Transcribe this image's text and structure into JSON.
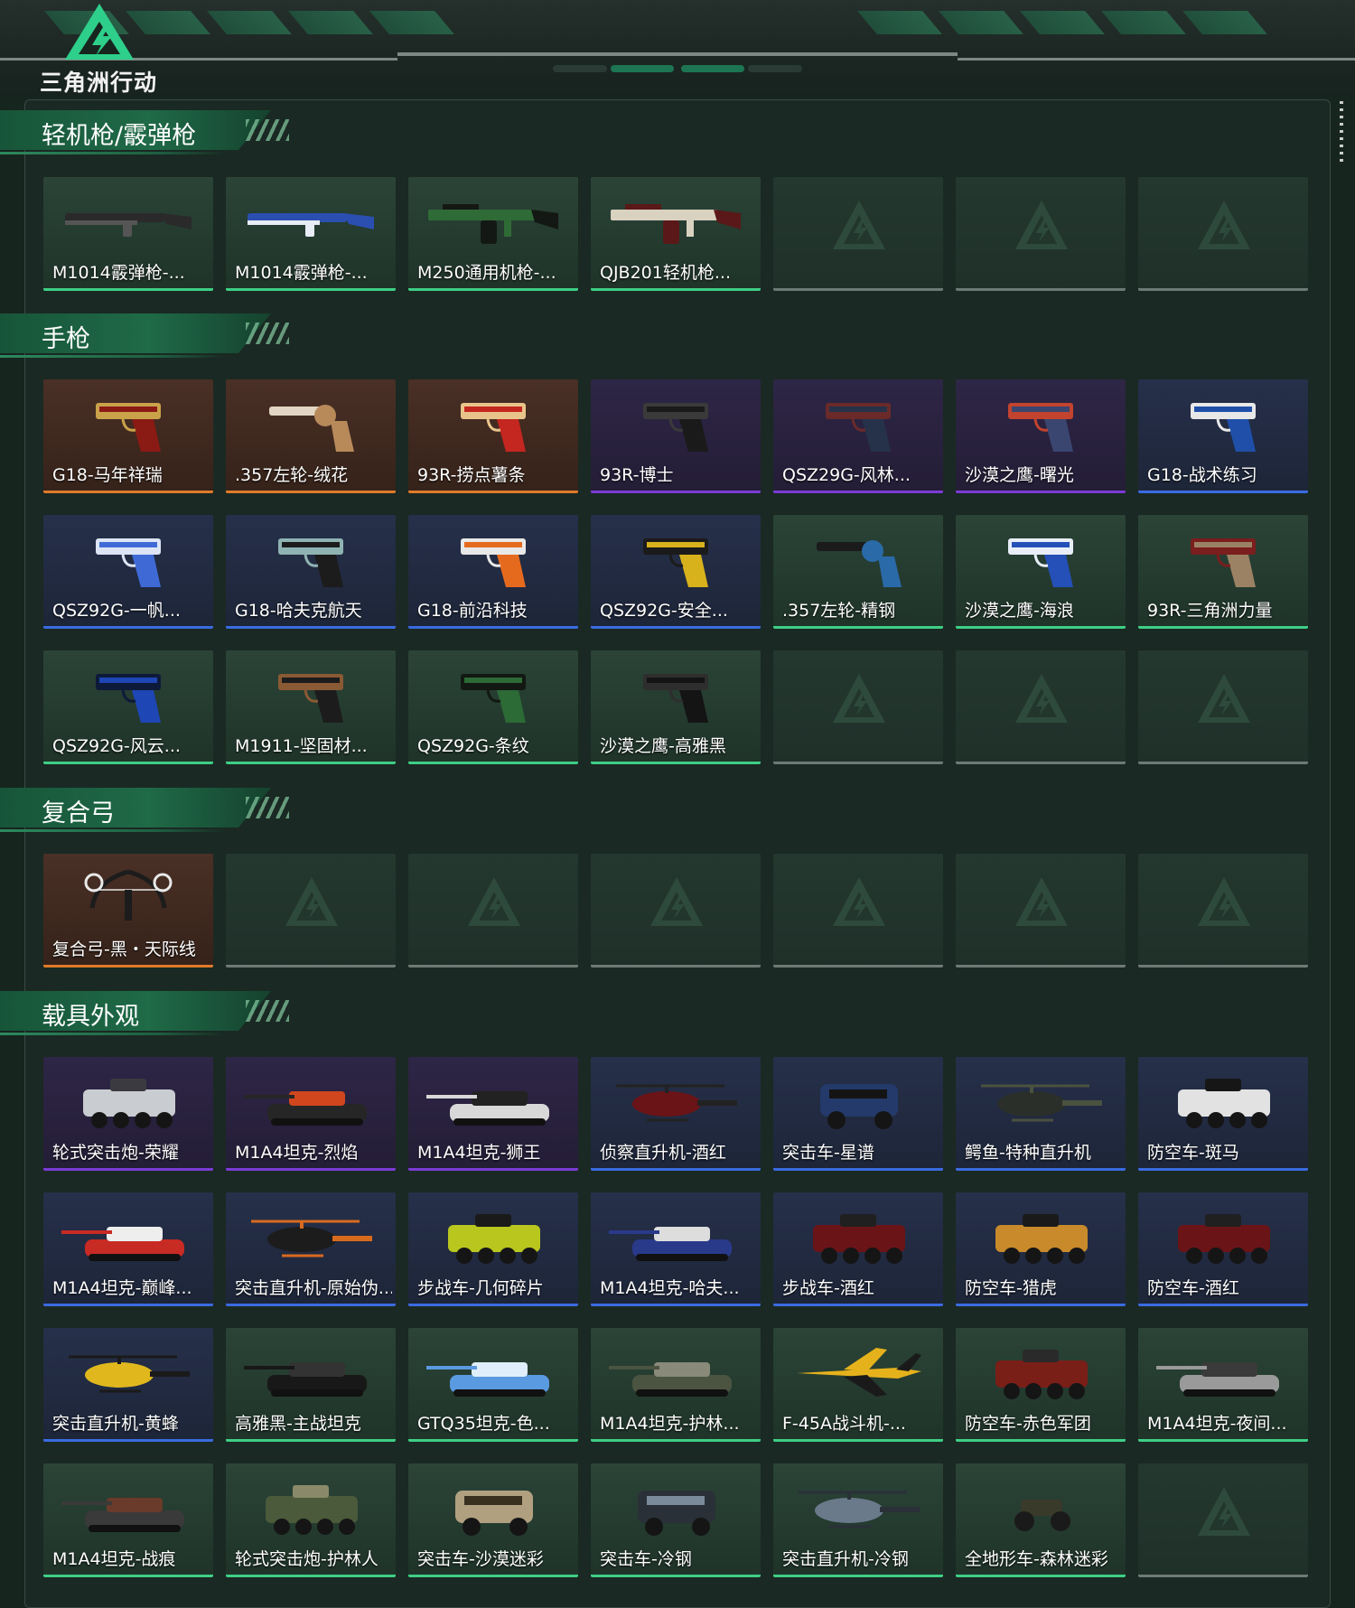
{
  "app": {
    "logo_text": "三角洲行动"
  },
  "sections": [
    {
      "title": "轻机枪/霰弹枪",
      "items": [
        {
          "name": "M1014霰弹枪-...",
          "kind": "shotgun",
          "rarity": "green",
          "colors": [
            "#2a2a2a",
            "#555555"
          ]
        },
        {
          "name": "M1014霰弹枪-...",
          "kind": "shotgun",
          "rarity": "green",
          "colors": [
            "#2b4fb0",
            "#e8ecf5"
          ]
        },
        {
          "name": "M250通用机枪-...",
          "kind": "mg",
          "rarity": "green",
          "colors": [
            "#2f6b36",
            "#141814"
          ]
        },
        {
          "name": "QJB201轻机枪...",
          "kind": "mg",
          "rarity": "green",
          "colors": [
            "#d9d2c0",
            "#5a1818"
          ]
        },
        null,
        null,
        null
      ]
    },
    {
      "title": "手枪",
      "items": [
        {
          "name": "G18-马年祥瑞",
          "kind": "pistol",
          "rarity": "orange",
          "colors": [
            "#8a1a14",
            "#c9a24a"
          ]
        },
        {
          "name": ".357左轮-绒花",
          "kind": "revolver",
          "rarity": "orange",
          "colors": [
            "#b88a5a",
            "#e2d6c2"
          ]
        },
        {
          "name": "93R-捞点薯条",
          "kind": "pistol",
          "rarity": "orange",
          "colors": [
            "#c42620",
            "#e9c48a"
          ]
        },
        {
          "name": "93R-博士",
          "kind": "pistol",
          "rarity": "purple",
          "colors": [
            "#1a1a1a",
            "#3a3a3a"
          ]
        },
        {
          "name": "QSZ29G-风林...",
          "kind": "pistol",
          "rarity": "purple",
          "colors": [
            "#26324a",
            "#6a2a2a"
          ]
        },
        {
          "name": "沙漠之鹰-曙光",
          "kind": "pistol",
          "rarity": "purple",
          "colors": [
            "#3a4670",
            "#c2432e"
          ]
        },
        {
          "name": "G18-战术练习",
          "kind": "pistol",
          "rarity": "blue",
          "colors": [
            "#1f4fa8",
            "#e8e8e8"
          ]
        },
        {
          "name": "QSZ92G-一帆...",
          "kind": "pistol",
          "rarity": "blue",
          "colors": [
            "#3f6ad6",
            "#dce4f5"
          ]
        },
        {
          "name": "G18-哈夫克航天",
          "kind": "pistol",
          "rarity": "blue",
          "colors": [
            "#1c1c1c",
            "#8fb3b3"
          ]
        },
        {
          "name": "G18-前沿科技",
          "kind": "pistol",
          "rarity": "blue",
          "colors": [
            "#e66a1e",
            "#e8e8e8"
          ]
        },
        {
          "name": "QSZ92G-安全...",
          "kind": "pistol",
          "rarity": "blue",
          "colors": [
            "#d8b21c",
            "#1b1b1b"
          ]
        },
        {
          "name": ".357左轮-精钢",
          "kind": "revolver",
          "rarity": "green",
          "colors": [
            "#2a6aa8",
            "#1b1b1b"
          ]
        },
        {
          "name": "沙漠之鹰-海浪",
          "kind": "pistol",
          "rarity": "green",
          "colors": [
            "#2450b8",
            "#e8eef7"
          ]
        },
        {
          "name": "93R-三角洲力量",
          "kind": "pistol",
          "rarity": "green",
          "colors": [
            "#9c8264",
            "#7a1e1e"
          ]
        },
        {
          "name": "QSZ92G-风云...",
          "kind": "pistol",
          "rarity": "green",
          "colors": [
            "#1e46b4",
            "#0e1a3a"
          ]
        },
        {
          "name": "M1911-坚固材...",
          "kind": "pistol",
          "rarity": "green",
          "colors": [
            "#1c1c1c",
            "#8a5a34"
          ]
        },
        {
          "name": "QSZ92G-条纹",
          "kind": "pistol",
          "rarity": "green",
          "colors": [
            "#2c6a36",
            "#121812"
          ]
        },
        {
          "name": "沙漠之鹰-高雅黑",
          "kind": "pistol",
          "rarity": "green",
          "colors": [
            "#141414",
            "#2e2e2e"
          ]
        },
        null,
        null,
        null
      ]
    },
    {
      "title": "复合弓",
      "items": [
        {
          "name": "复合弓-黑・天际线",
          "kind": "bow",
          "rarity": "orange",
          "colors": [
            "#1c1c1c",
            "#e8e8e8"
          ]
        },
        null,
        null,
        null,
        null,
        null,
        null
      ]
    },
    {
      "title": "载具外观",
      "items": [
        {
          "name": "轮式突击炮-荣耀",
          "kind": "apc",
          "rarity": "purple",
          "colors": [
            "#c9ccd0",
            "#3a3a40"
          ]
        },
        {
          "name": "M1A4坦克-烈焰",
          "kind": "tank",
          "rarity": "purple",
          "colors": [
            "#262626",
            "#d2461e"
          ]
        },
        {
          "name": "M1A4坦克-狮王",
          "kind": "tank",
          "rarity": "purple",
          "colors": [
            "#d8d8d8",
            "#222222"
          ]
        },
        {
          "name": "侦察直升机-酒红",
          "kind": "heli",
          "rarity": "blue",
          "colors": [
            "#6a1418",
            "#222222"
          ]
        },
        {
          "name": "突击车-星谱",
          "kind": "truck",
          "rarity": "blue",
          "colors": [
            "#233a6a",
            "#141414"
          ]
        },
        {
          "name": "鳄鱼-特种直升机",
          "kind": "heli",
          "rarity": "blue",
          "colors": [
            "#2b2f2a",
            "#4a5240"
          ]
        },
        {
          "name": "防空车-斑马",
          "kind": "apc",
          "rarity": "blue",
          "colors": [
            "#e2e2e2",
            "#161616"
          ]
        },
        {
          "name": "M1A4坦克-巅峰...",
          "kind": "tank",
          "rarity": "blue",
          "colors": [
            "#c82a24",
            "#eeeeee"
          ]
        },
        {
          "name": "突击直升机-原始伪...",
          "kind": "heli",
          "rarity": "blue",
          "colors": [
            "#1c1c1c",
            "#d86a1e"
          ]
        },
        {
          "name": "步战车-几何碎片",
          "kind": "apc",
          "rarity": "blue",
          "colors": [
            "#b8c61e",
            "#1a1a1a"
          ]
        },
        {
          "name": "M1A4坦克-哈夫...",
          "kind": "tank",
          "rarity": "blue",
          "colors": [
            "#2a3a8a",
            "#dddddd"
          ]
        },
        {
          "name": "步战车-酒红",
          "kind": "apc",
          "rarity": "blue",
          "colors": [
            "#6a1418",
            "#202020"
          ]
        },
        {
          "name": "防空车-猎虎",
          "kind": "apc",
          "rarity": "blue",
          "colors": [
            "#c88a2a",
            "#1a1a1a"
          ]
        },
        {
          "name": "防空车-酒红",
          "kind": "apc",
          "rarity": "blue",
          "colors": [
            "#6a1418",
            "#202020"
          ]
        },
        {
          "name": "突击直升机-黄蜂",
          "kind": "heli",
          "rarity": "blue",
          "colors": [
            "#e0b81e",
            "#1a1a1a"
          ]
        },
        {
          "name": "高雅黑-主战坦克",
          "kind": "tank",
          "rarity": "green",
          "colors": [
            "#181818",
            "#333333"
          ]
        },
        {
          "name": "GTQ35坦克-色...",
          "kind": "tank",
          "rarity": "green",
          "colors": [
            "#5a9ae0",
            "#dfeefa"
          ]
        },
        {
          "name": "M1A4坦克-护林...",
          "kind": "tank",
          "rarity": "green",
          "colors": [
            "#4a5440",
            "#8a8a7a"
          ]
        },
        {
          "name": "F-45A战斗机-...",
          "kind": "jet",
          "rarity": "green",
          "colors": [
            "#e6b21c",
            "#1a1a1a"
          ]
        },
        {
          "name": "防空车-赤色军团",
          "kind": "apc",
          "rarity": "green",
          "colors": [
            "#7a1e18",
            "#2a2a2a"
          ]
        },
        {
          "name": "M1A4坦克-夜间...",
          "kind": "tank",
          "rarity": "green",
          "colors": [
            "#9a9a9a",
            "#3a3a3a"
          ]
        },
        {
          "name": "M1A4坦克-战痕",
          "kind": "tank",
          "rarity": "green",
          "colors": [
            "#3a3a3a",
            "#6a3a2a"
          ]
        },
        {
          "name": "轮式突击炮-护林人",
          "kind": "apc",
          "rarity": "green",
          "colors": [
            "#4a5a3a",
            "#8a8a6a"
          ]
        },
        {
          "name": "突击车-沙漠迷彩",
          "kind": "truck",
          "rarity": "green",
          "colors": [
            "#b0a080",
            "#3a3020"
          ]
        },
        {
          "name": "突击车-冷钢",
          "kind": "truck",
          "rarity": "green",
          "colors": [
            "#2a3038",
            "#7a8a9a"
          ]
        },
        {
          "name": "突击直升机-冷钢",
          "kind": "heli",
          "rarity": "green",
          "colors": [
            "#6a7a8a",
            "#2a3038"
          ]
        },
        {
          "name": "全地形车-森林迷彩",
          "kind": "atv",
          "rarity": "green",
          "colors": [
            "#3a3a2a",
            "#1a1a1a"
          ]
        },
        null
      ]
    }
  ],
  "rarity_colors": {
    "green": "#3ecf86",
    "orange": "#e07a2a",
    "purple": "#7b3bd6",
    "blue": "#3a6be0"
  },
  "rarity_bg": {
    "green": [
      "#2b4437",
      "#1f3329"
    ],
    "orange": [
      "#4a3026",
      "#352219"
    ],
    "purple": [
      "#2e2646",
      "#241d36"
    ],
    "blue": [
      "#26304a",
      "#1d2538"
    ]
  }
}
